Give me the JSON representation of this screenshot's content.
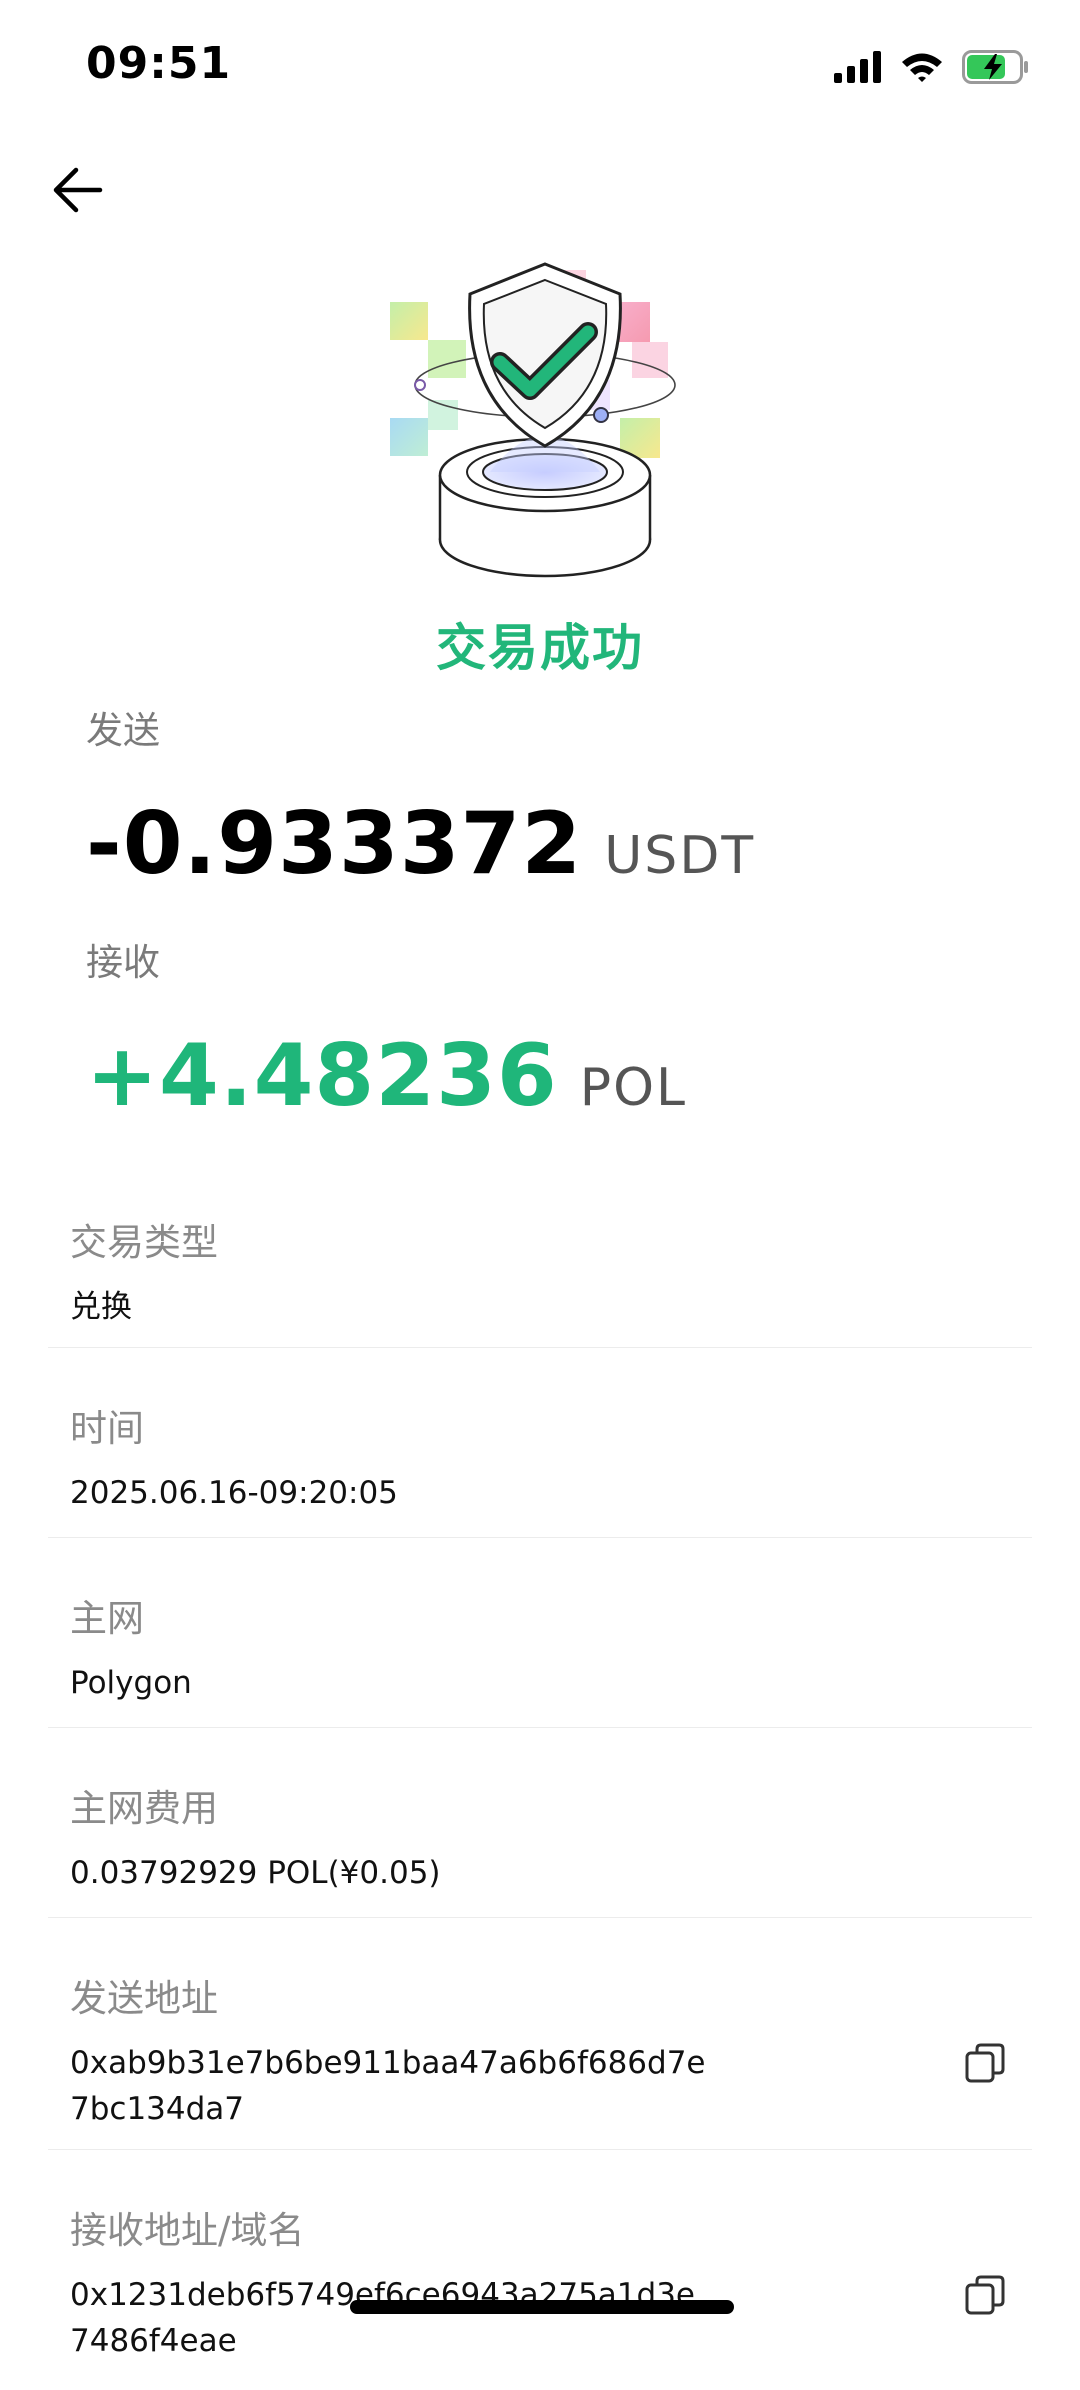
{
  "status_bar": {
    "time": "09:51"
  },
  "nav": {
    "back_icon": "arrow-left-icon"
  },
  "result": {
    "title": "交易成功",
    "accent_color": "#22b67a"
  },
  "send": {
    "label": "发送",
    "amount": "-0.933372",
    "unit": "USDT"
  },
  "receive": {
    "label": "接收",
    "amount": "+4.48236",
    "unit": "POL"
  },
  "details": {
    "type": {
      "label": "交易类型",
      "value": "兑换"
    },
    "time": {
      "label": "时间",
      "value": "2025.06.16-09:20:05"
    },
    "network": {
      "label": "主网",
      "value": "Polygon"
    },
    "fee": {
      "label": "主网费用",
      "value": "0.03792929 POL(¥0.05)"
    },
    "from": {
      "label": "发送地址",
      "value": "0xab9b31e7b6be911baa47a6b6f686d7e7bc134da7"
    },
    "to": {
      "label": "接收地址/域名",
      "value": "0x1231deb6f5749ef6ce6943a275a1d3e7486f4eae"
    }
  }
}
